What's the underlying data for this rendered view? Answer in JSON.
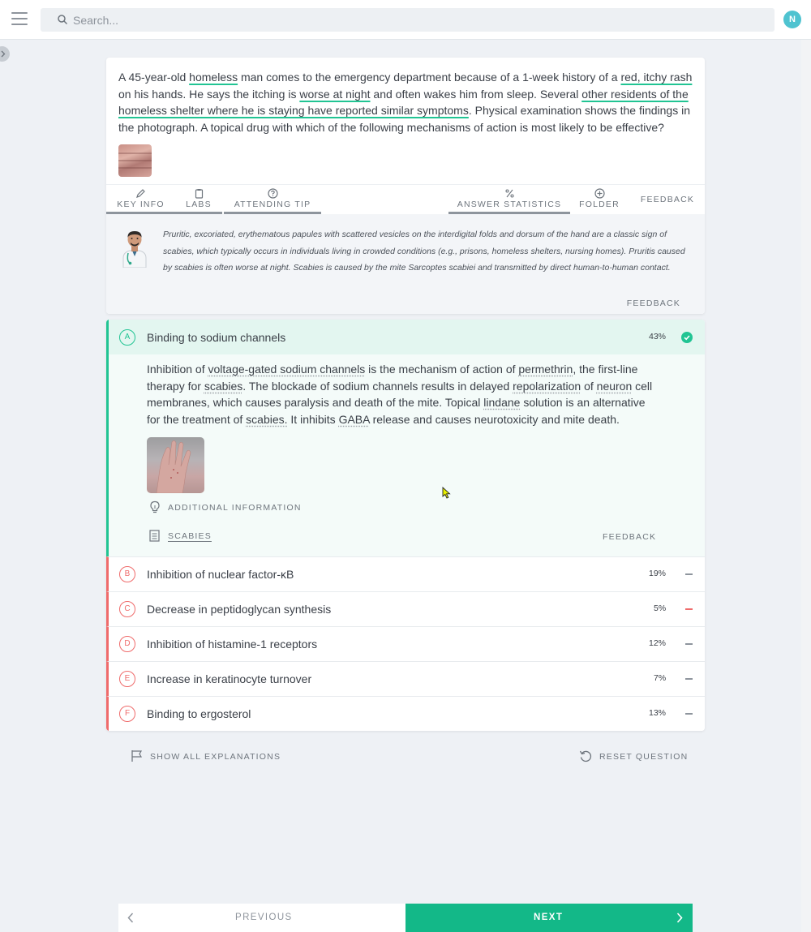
{
  "header": {
    "search_placeholder": "Search...",
    "avatar_initial": "N"
  },
  "question": {
    "stem_parts": [
      {
        "text": "A 45-year-old ",
        "hl": false
      },
      {
        "text": "homeless",
        "hl": true
      },
      {
        "text": " man comes to the emergency department because of a 1-week history of a ",
        "hl": false
      },
      {
        "text": "red, itchy rash",
        "hl": true
      },
      {
        "text": " on his hands. He says the itching is ",
        "hl": false
      },
      {
        "text": "worse at night",
        "hl": true
      },
      {
        "text": " and often wakes him from sleep. Several ",
        "hl": false
      },
      {
        "text": "other residents of the homeless shelter where he is staying have reported similar symptoms",
        "hl": true
      },
      {
        "text": ". Physical examination shows the findings in the photograph. A topical drug with which of the following mechanisms of action is most likely to be effective?",
        "hl": false
      }
    ]
  },
  "tabs": {
    "key_info": "KEY INFO",
    "labs": "LABS",
    "attending_tip": "ATTENDING TIP",
    "answer_statistics": "ANSWER STATISTICS",
    "folder": "FOLDER",
    "feedback": "FEEDBACK"
  },
  "tip": {
    "text": "Pruritic, excoriated, erythematous papules with scattered vesicles on the interdigital folds and dorsum of the hand are a classic sign of scabies, which typically occurs in individuals living in crowded conditions (e.g., prisons, homeless shelters, nursing homes). Pruritis caused by scabies is often worse at night. Scabies is caused by the mite Sarcoptes scabiei and transmitted by direct human-to-human contact.",
    "feedback": "FEEDBACK"
  },
  "answers": [
    {
      "letter": "A",
      "label": "Binding to sodium channels",
      "pct": "43%",
      "correct": true
    },
    {
      "letter": "B",
      "label": "Inhibition of nuclear factor-κB",
      "pct": "19%",
      "correct": false
    },
    {
      "letter": "C",
      "label": "Decrease in peptidoglycan synthesis",
      "pct": "5%",
      "correct": false
    },
    {
      "letter": "D",
      "label": "Inhibition of histamine-1 receptors",
      "pct": "12%",
      "correct": false
    },
    {
      "letter": "E",
      "label": "Increase in keratinocyte turnover",
      "pct": "7%",
      "correct": false
    },
    {
      "letter": "F",
      "label": "Binding to ergosterol",
      "pct": "13%",
      "correct": false
    }
  ],
  "explanation": {
    "parts": [
      {
        "text": "Inhibition of ",
        "dl": false
      },
      {
        "text": "voltage-gated sodium channels",
        "dl": true
      },
      {
        "text": " is the mechanism of action of ",
        "dl": false
      },
      {
        "text": "permethrin",
        "dl": true
      },
      {
        "text": ", the first-line therapy for ",
        "dl": false
      },
      {
        "text": "scabies",
        "dl": true
      },
      {
        "text": ". The blockade of sodium channels results in delayed ",
        "dl": false
      },
      {
        "text": "repolarization",
        "dl": true
      },
      {
        "text": " of ",
        "dl": false
      },
      {
        "text": "neuron",
        "dl": true
      },
      {
        "text": " cell membranes, which causes paralysis and death of the mite. Topical ",
        "dl": false
      },
      {
        "text": "lindane",
        "dl": true
      },
      {
        "text": " solution is an alternative for the treatment of ",
        "dl": false
      },
      {
        "text": "scabies.",
        "dl": true
      },
      {
        "text": " It inhibits ",
        "dl": false
      },
      {
        "text": "GABA",
        "dl": true
      },
      {
        "text": " release and causes neurotoxicity and mite death.",
        "dl": false
      }
    ],
    "additional_info": "ADDITIONAL INFORMATION",
    "topic": "SCABIES",
    "feedback": "FEEDBACK"
  },
  "actions": {
    "show_all": "SHOW ALL EXPLANATIONS",
    "reset": "RESET QUESTION"
  },
  "nav": {
    "previous": "PREVIOUS",
    "next": "NEXT"
  },
  "colors": {
    "accent": "#13b888",
    "highlight": "#21c493",
    "wrong": "#ef6b6b"
  }
}
